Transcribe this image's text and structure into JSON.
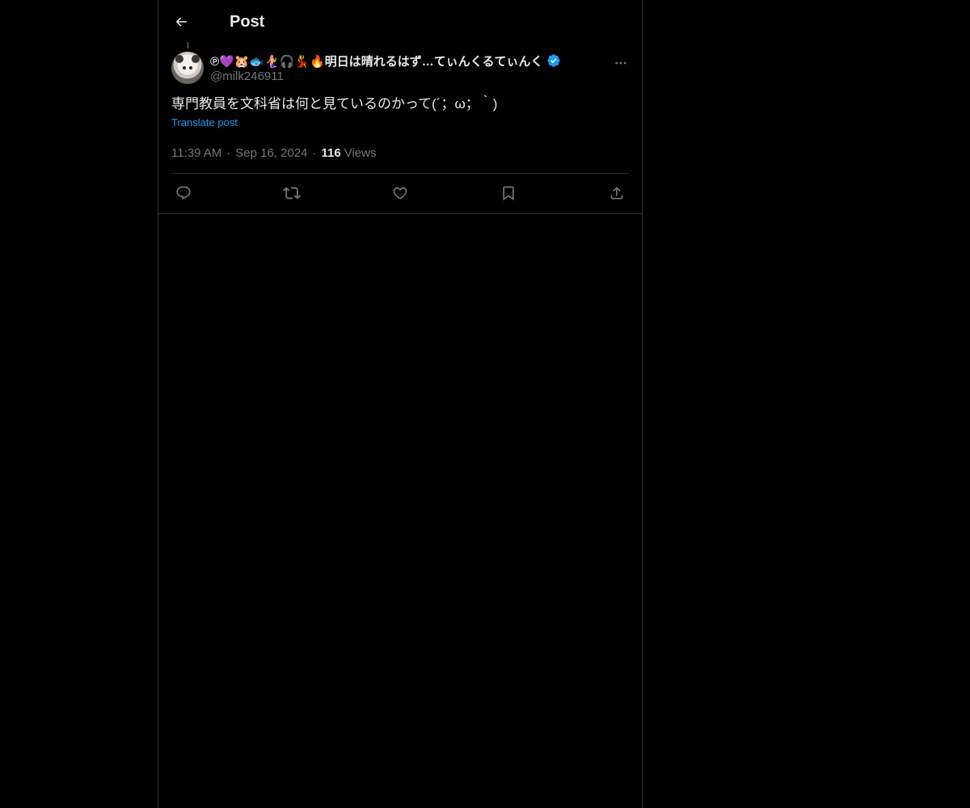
{
  "header": {
    "title": "Post"
  },
  "post": {
    "author": {
      "display_name": "℗💜🐹🐟🧜‍♀️🎧💃🔥明日は晴れるはず…てぃんくるてぃんく",
      "handle": "@milk246911",
      "verified": true
    },
    "text": "専門教員を文科省は何と見ているのかって(´；ω；｀)",
    "translate_label": "Translate post",
    "time": "11:39 AM",
    "date": "Sep 16, 2024",
    "views_count": "116",
    "views_label": "Views",
    "separator": "·"
  },
  "icons": {
    "back": "arrow-left-icon",
    "more": "more-horizontal-icon",
    "verified": "verified-badge-icon",
    "reply": "reply-icon",
    "repost": "repost-icon",
    "like": "heart-icon",
    "bookmark": "bookmark-icon",
    "share": "share-icon"
  },
  "colors": {
    "background": "#000000",
    "text_primary": "#e7e9ea",
    "text_secondary": "#71767b",
    "accent": "#1d9bf0",
    "border": "#2f3336"
  }
}
